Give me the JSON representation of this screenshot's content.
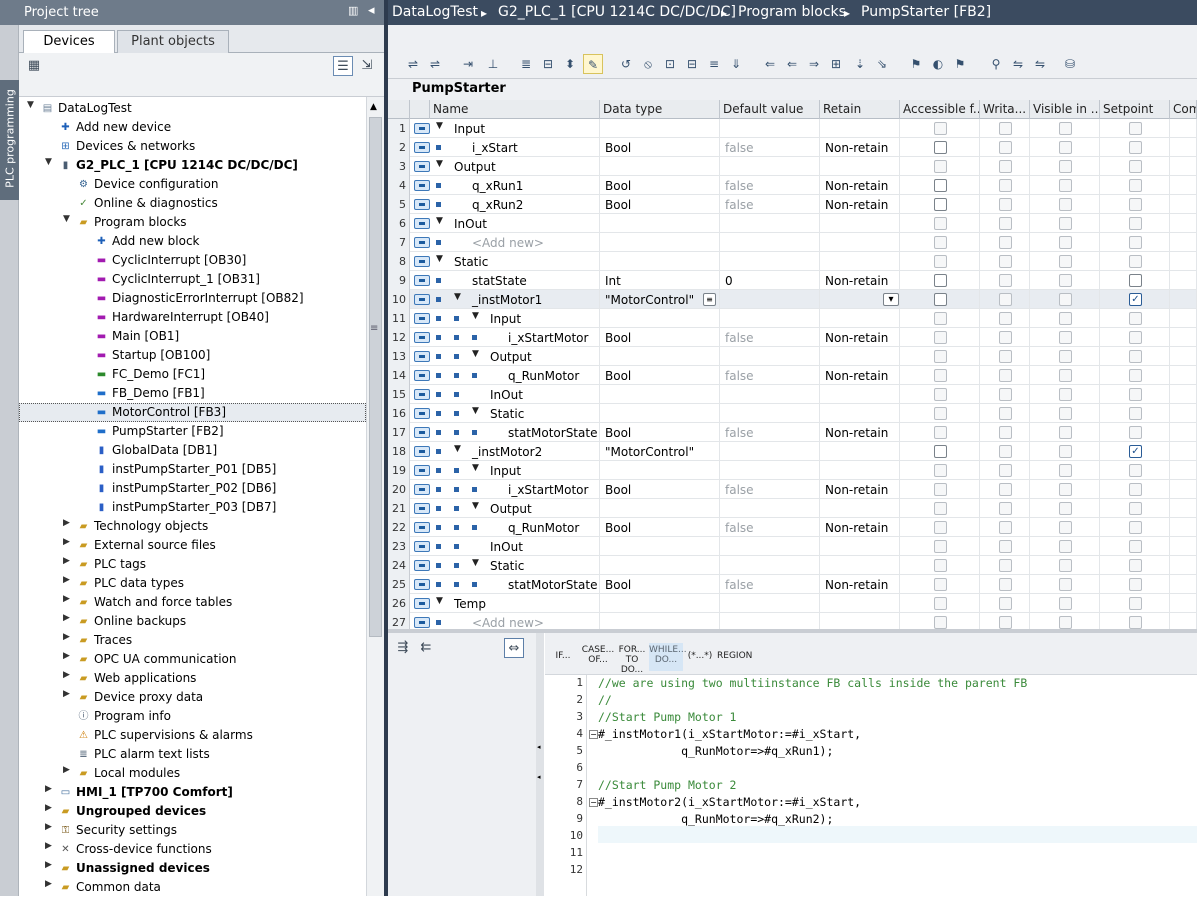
{
  "side_tab": "PLC programming",
  "project_tree": {
    "title": "Project tree",
    "pin_icon": "pin-icon",
    "collapse_icon": "◂",
    "tabs": [
      "Devices",
      "Plant objects"
    ],
    "items": [
      {
        "label": "DataLogTest",
        "arrow": "▼",
        "icon": "project-icon"
      },
      {
        "label": "Add new device",
        "icon": "add-device-icon"
      },
      {
        "label": "Devices & networks",
        "icon": "network-icon"
      },
      {
        "label": "G2_PLC_1 [CPU 1214C DC/DC/DC]",
        "arrow": "▼",
        "icon": "cpu-icon",
        "bold": true
      },
      {
        "label": "Device configuration",
        "icon": "config-icon"
      },
      {
        "label": "Online & diagnostics",
        "icon": "diagnostics-icon"
      },
      {
        "label": "Program blocks",
        "arrow": "▼",
        "icon": "folder-icon"
      },
      {
        "label": "Add new block",
        "icon": "add-block-icon"
      },
      {
        "label": "CyclicInterrupt [OB30]",
        "icon": "ob-icon"
      },
      {
        "label": "CyclicInterrupt_1 [OB31]",
        "icon": "ob-icon"
      },
      {
        "label": "DiagnosticErrorInterrupt [OB82]",
        "icon": "ob-icon"
      },
      {
        "label": "HardwareInterrupt [OB40]",
        "icon": "ob-icon"
      },
      {
        "label": "Main [OB1]",
        "icon": "ob-icon"
      },
      {
        "label": "Startup [OB100]",
        "icon": "ob-icon"
      },
      {
        "label": "FC_Demo [FC1]",
        "icon": "fc-icon"
      },
      {
        "label": "FB_Demo [FB1]",
        "icon": "fb-icon"
      },
      {
        "label": "MotorControl [FB3]",
        "icon": "fb-icon",
        "selected": true
      },
      {
        "label": "PumpStarter [FB2]",
        "icon": "fb-icon"
      },
      {
        "label": "GlobalData [DB1]",
        "icon": "db-icon"
      },
      {
        "label": "instPumpStarter_P01 [DB5]",
        "icon": "db-icon"
      },
      {
        "label": "instPumpStarter_P02 [DB6]",
        "icon": "db-icon"
      },
      {
        "label": "instPumpStarter_P03 [DB7]",
        "icon": "db-icon"
      },
      {
        "label": "Technology objects",
        "arrow": "▶",
        "icon": "folder-icon"
      },
      {
        "label": "External source files",
        "arrow": "▶",
        "icon": "folder-icon"
      },
      {
        "label": "PLC tags",
        "arrow": "▶",
        "icon": "folder-icon"
      },
      {
        "label": "PLC data types",
        "arrow": "▶",
        "icon": "folder-icon"
      },
      {
        "label": "Watch and force tables",
        "arrow": "▶",
        "icon": "folder-icon"
      },
      {
        "label": "Online backups",
        "arrow": "▶",
        "icon": "folder-icon"
      },
      {
        "label": "Traces",
        "arrow": "▶",
        "icon": "folder-icon"
      },
      {
        "label": "OPC UA communication",
        "arrow": "▶",
        "icon": "folder-icon"
      },
      {
        "label": "Web applications",
        "arrow": "▶",
        "icon": "folder-icon"
      },
      {
        "label": "Device proxy data",
        "arrow": "▶",
        "icon": "folder-icon"
      },
      {
        "label": "Program info",
        "icon": "info-icon"
      },
      {
        "label": "PLC supervisions & alarms",
        "icon": "alarm-icon"
      },
      {
        "label": "PLC alarm text lists",
        "icon": "text-list-icon"
      },
      {
        "label": "Local modules",
        "arrow": "▶",
        "icon": "folder-icon"
      },
      {
        "label": "HMI_1 [TP700 Comfort]",
        "arrow": "▶",
        "icon": "hmi-icon",
        "bold": true
      },
      {
        "label": "Ungrouped devices",
        "arrow": "▶",
        "icon": "folder-icon",
        "bold": true
      },
      {
        "label": "Security settings",
        "arrow": "▶",
        "icon": "security-icon"
      },
      {
        "label": "Cross-device functions",
        "arrow": "▶",
        "icon": "cross-icon"
      },
      {
        "label": "Unassigned devices",
        "arrow": "▶",
        "icon": "folder-icon",
        "bold": true
      },
      {
        "label": "Common data",
        "arrow": "▶",
        "icon": "folder-icon"
      }
    ]
  },
  "breadcrumb": [
    "DataLogTest",
    "G2_PLC_1 [CPU 1214C DC/DC/DC]",
    "Program blocks",
    "PumpStarter [FB2]"
  ],
  "breadcrumb_sep": "▸",
  "block_name": "PumpStarter",
  "interface": {
    "columns": [
      "Name",
      "Data type",
      "Default value",
      "Retain",
      "Accessible f...",
      "Writa...",
      "Visible in ...",
      "Setpoint",
      "Com"
    ],
    "rows": [
      {
        "num": "1",
        "name": "Input",
        "dtype": "",
        "def": "",
        "retain": "",
        "section": true,
        "cbs": "o"
      },
      {
        "num": "2",
        "name": "i_xStart",
        "dtype": "Bool",
        "def": "false",
        "retain": "Non-retain",
        "cbs": "e"
      },
      {
        "num": "3",
        "name": "Output",
        "dtype": "",
        "def": "",
        "retain": "",
        "section": true,
        "cbs": "o"
      },
      {
        "num": "4",
        "name": "q_xRun1",
        "dtype": "Bool",
        "def": "false",
        "retain": "Non-retain",
        "cbs": "e"
      },
      {
        "num": "5",
        "name": "q_xRun2",
        "dtype": "Bool",
        "def": "false",
        "retain": "Non-retain",
        "cbs": "e"
      },
      {
        "num": "6",
        "name": "InOut",
        "dtype": "",
        "def": "",
        "retain": "",
        "section": true,
        "cbs": "o"
      },
      {
        "num": "7",
        "name": "<Add new>",
        "dtype": "",
        "def": "",
        "retain": "",
        "add": true,
        "cbs": "o"
      },
      {
        "num": "8",
        "name": "Static",
        "dtype": "",
        "def": "",
        "retain": "",
        "section": true,
        "cbs": "o"
      },
      {
        "num": "9",
        "name": "statState",
        "dtype": "Int",
        "def": "0",
        "retain": "Non-retain",
        "cbs": "e2"
      },
      {
        "num": "10",
        "name": "_instMotor1",
        "dtype": "\"MotorControl\"",
        "def": "",
        "retain": "",
        "lvl": 1,
        "arrow": true,
        "sel": true,
        "cbs": "m"
      },
      {
        "num": "11",
        "name": "Input",
        "dtype": "",
        "def": "",
        "retain": "",
        "lvl": 2,
        "arrow": true,
        "cbs": "o"
      },
      {
        "num": "12",
        "name": "i_xStartMotor",
        "dtype": "Bool",
        "def": "false",
        "retain": "Non-retain",
        "lvl": 3,
        "cbs": "o"
      },
      {
        "num": "13",
        "name": "Output",
        "dtype": "",
        "def": "",
        "retain": "",
        "lvl": 2,
        "arrow": true,
        "cbs": "o"
      },
      {
        "num": "14",
        "name": "q_RunMotor",
        "dtype": "Bool",
        "def": "false",
        "retain": "Non-retain",
        "lvl": 3,
        "cbs": "o"
      },
      {
        "num": "15",
        "name": "InOut",
        "dtype": "",
        "def": "",
        "retain": "",
        "lvl": 2,
        "cbs": "o"
      },
      {
        "num": "16",
        "name": "Static",
        "dtype": "",
        "def": "",
        "retain": "",
        "lvl": 2,
        "arrow": true,
        "cbs": "o"
      },
      {
        "num": "17",
        "name": "statMotorState",
        "dtype": "Bool",
        "def": "false",
        "retain": "Non-retain",
        "lvl": 3,
        "cbs": "o"
      },
      {
        "num": "18",
        "name": "_instMotor2",
        "dtype": "\"MotorControl\"",
        "def": "",
        "retain": "",
        "lvl": 1,
        "arrow": true,
        "cbs": "m"
      },
      {
        "num": "19",
        "name": "Input",
        "dtype": "",
        "def": "",
        "retain": "",
        "lvl": 2,
        "arrow": true,
        "cbs": "o"
      },
      {
        "num": "20",
        "name": "i_xStartMotor",
        "dtype": "Bool",
        "def": "false",
        "retain": "Non-retain",
        "lvl": 3,
        "cbs": "o"
      },
      {
        "num": "21",
        "name": "Output",
        "dtype": "",
        "def": "",
        "retain": "",
        "lvl": 2,
        "arrow": true,
        "cbs": "o"
      },
      {
        "num": "22",
        "name": "q_RunMotor",
        "dtype": "Bool",
        "def": "false",
        "retain": "Non-retain",
        "lvl": 3,
        "cbs": "o"
      },
      {
        "num": "23",
        "name": "InOut",
        "dtype": "",
        "def": "",
        "retain": "",
        "lvl": 2,
        "cbs": "o"
      },
      {
        "num": "24",
        "name": "Static",
        "dtype": "",
        "def": "",
        "retain": "",
        "lvl": 2,
        "arrow": true,
        "cbs": "o"
      },
      {
        "num": "25",
        "name": "statMotorState",
        "dtype": "Bool",
        "def": "false",
        "retain": "Non-retain",
        "lvl": 3,
        "cbs": "o"
      },
      {
        "num": "26",
        "name": "Temp",
        "dtype": "",
        "def": "",
        "retain": "",
        "section": true,
        "cbs": "o"
      },
      {
        "num": "27",
        "name": "<Add new>",
        "dtype": "",
        "def": "",
        "retain": "",
        "add": true,
        "cbs": "o"
      }
    ]
  },
  "scl_keywords": [
    "IF...",
    "CASE... OF...",
    "FOR... TO DO...",
    "WHILE... DO...",
    "(*...*)",
    "REGION"
  ],
  "code_lines": [
    {
      "n": "1",
      "text": "//we are using two multiinstance FB calls inside the parent FB",
      "comment": true
    },
    {
      "n": "2",
      "text": "//",
      "comment": true
    },
    {
      "n": "3",
      "text": "//Start Pump Motor 1",
      "comment": true
    },
    {
      "n": "4",
      "text": "#_instMotor1(i_xStartMotor:=#i_xStart,",
      "fold": true
    },
    {
      "n": "5",
      "text": "            q_RunMotor=>#q_xRun1);"
    },
    {
      "n": "6",
      "text": ""
    },
    {
      "n": "7",
      "text": "//Start Pump Motor 2",
      "comment": true
    },
    {
      "n": "8",
      "text": "#_instMotor2(i_xStartMotor:=#i_xStart,",
      "fold": true
    },
    {
      "n": "9",
      "text": "            q_RunMotor=>#q_xRun2);"
    },
    {
      "n": "10",
      "text": ""
    },
    {
      "n": "11",
      "text": ""
    },
    {
      "n": "12",
      "text": ""
    }
  ],
  "colors": {
    "accent": "#3b4b60",
    "tree_title": "#6e7b8a",
    "comment": "#3a8a3a"
  }
}
